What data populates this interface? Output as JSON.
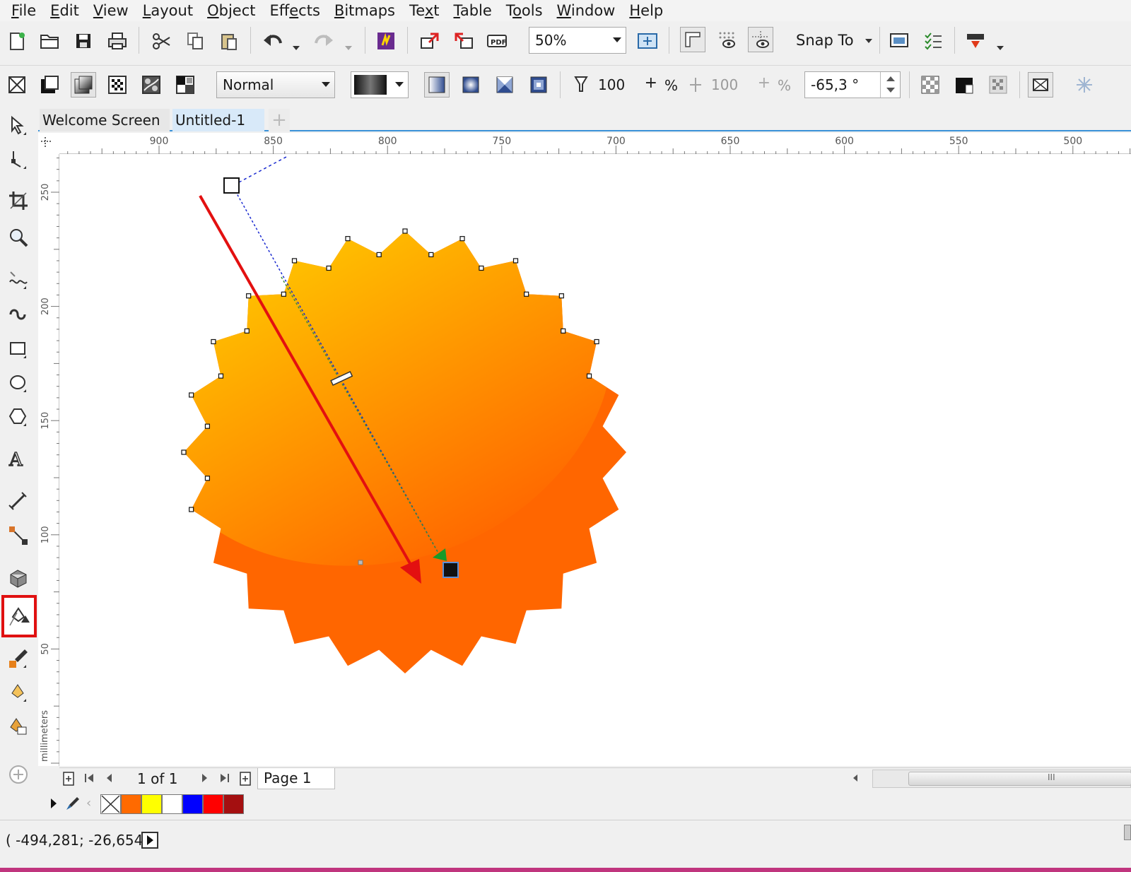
{
  "menu": {
    "items": [
      {
        "pre": "",
        "ul": "F",
        "post": "ile"
      },
      {
        "pre": "",
        "ul": "E",
        "post": "dit"
      },
      {
        "pre": "",
        "ul": "V",
        "post": "iew"
      },
      {
        "pre": "",
        "ul": "L",
        "post": "ayout"
      },
      {
        "pre": "",
        "ul": "O",
        "post": "bject"
      },
      {
        "pre": "Eff",
        "ul": "e",
        "post": "cts"
      },
      {
        "pre": "",
        "ul": "B",
        "post": "itmaps"
      },
      {
        "pre": "Te",
        "ul": "x",
        "post": "t"
      },
      {
        "pre": "",
        "ul": "T",
        "post": "able"
      },
      {
        "pre": "T",
        "ul": "o",
        "post": "ols"
      },
      {
        "pre": "",
        "ul": "W",
        "post": "indow"
      },
      {
        "pre": "",
        "ul": "H",
        "post": "elp"
      }
    ]
  },
  "toolbar": {
    "zoom": "50%",
    "snap_to": "Snap To"
  },
  "property_bar": {
    "blend_mode": "Normal",
    "opacity_start": "100",
    "opacity_start_unit": "%",
    "opacity_end": "100",
    "opacity_end_unit": "%",
    "angle": "-65,3 °"
  },
  "tabs": {
    "welcome": "Welcome Screen",
    "untitled": "Untitled-1",
    "add": "+"
  },
  "ruler": {
    "h_labels": [
      "900",
      "850",
      "800",
      "750",
      "700",
      "650",
      "600",
      "550",
      "500"
    ],
    "v_labels": [
      "250",
      "200",
      "150",
      "100",
      "50"
    ],
    "unit": "millimeters"
  },
  "pagenav": {
    "count": "1 of 1",
    "page_tab": "Page 1",
    "scroll_grip": "III"
  },
  "palette": {
    "colors": [
      "#ff6a00",
      "#ffff00",
      "#ffffff",
      "#0000ff",
      "#ff0000",
      "#a40f10"
    ]
  },
  "status": {
    "coords": "( -494,281; -26,654 )"
  },
  "colors": {
    "fill_start": "#ffd800",
    "fill_end": "#ff6600",
    "accent": "#3a92d8",
    "annotation_arrow": "#e31010"
  }
}
